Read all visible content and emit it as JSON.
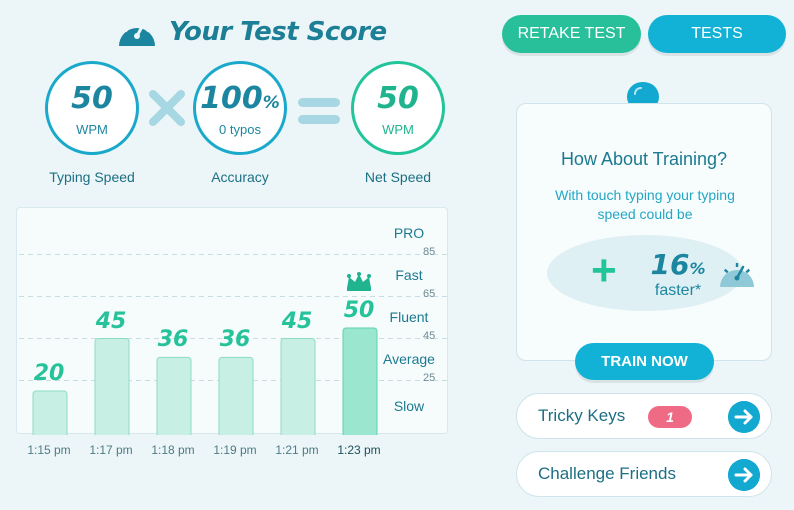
{
  "header": {
    "title": "Your Test Score"
  },
  "buttons": {
    "retake": "RETAKE TEST",
    "tests": "TESTS",
    "train": "TRAIN NOW"
  },
  "score": {
    "typing_speed": {
      "value": "50",
      "unit": "WPM",
      "caption": "Typing Speed"
    },
    "accuracy": {
      "value": "100",
      "unit_symbol": "%",
      "sub": "0  typos",
      "caption": "Accuracy"
    },
    "net_speed": {
      "value": "50",
      "unit": "WPM",
      "caption": "Net Speed"
    }
  },
  "chart_data": {
    "type": "bar",
    "categories": [
      "1:15 pm",
      "1:17 pm",
      "1:18 pm",
      "1:19 pm",
      "1:21 pm",
      "1:23 pm"
    ],
    "values": [
      20,
      45,
      36,
      36,
      45,
      50
    ],
    "value_labels": [
      "20",
      "45",
      "36",
      "36",
      "45",
      "50"
    ],
    "highlight_index": 5,
    "ylim": [
      0,
      105
    ],
    "ticks": [
      "85",
      "65",
      "45",
      "25"
    ],
    "levels": [
      "PRO",
      "Fast",
      "Fluent",
      "Average",
      "Slow"
    ],
    "grid": "dashed"
  },
  "training": {
    "title": "How About Training?",
    "description": "With touch typing your typing speed could be",
    "percent": "16",
    "percent_symbol": "%",
    "faster": "faster*"
  },
  "list": {
    "tricky_keys": {
      "label": "Tricky Keys",
      "badge": "1"
    },
    "challenge": {
      "label": "Challenge Friends"
    }
  },
  "icons": [
    "gauge-icon",
    "multiply-icon",
    "equals-icon",
    "crown-icon",
    "lightbulb-icon",
    "arrow-right-icon"
  ],
  "colors": {
    "teal": "#12b2d6",
    "green": "#22c49a",
    "badge": "#ef6b85",
    "bar_fill": "#c7efe3",
    "bar_highlight": "#9ae6cf"
  }
}
